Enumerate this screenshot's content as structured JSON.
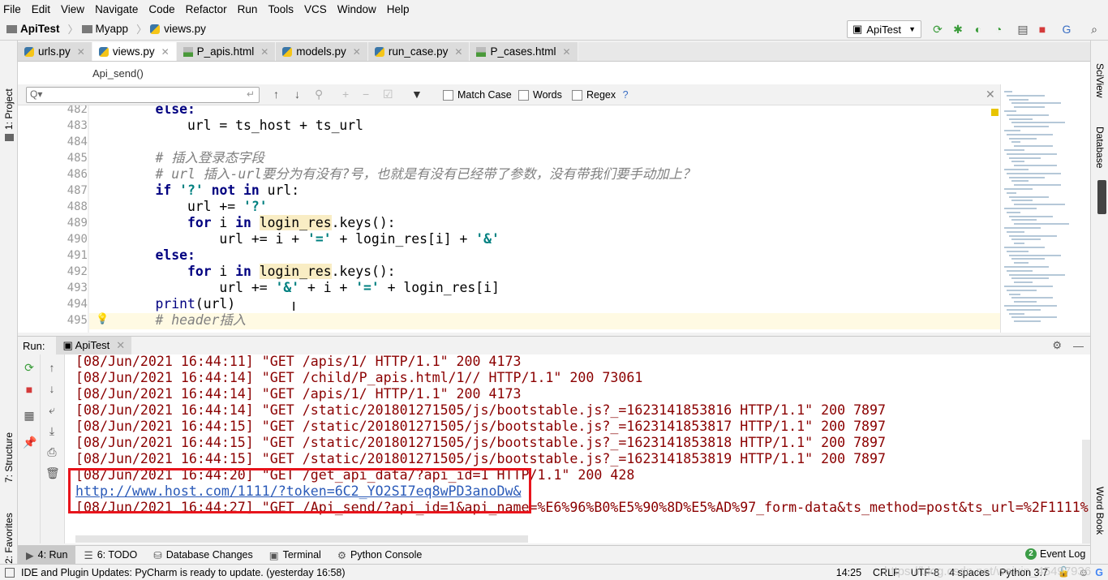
{
  "menu": [
    "File",
    "Edit",
    "View",
    "Navigate",
    "Code",
    "Refactor",
    "Run",
    "Tools",
    "VCS",
    "Window",
    "Help"
  ],
  "breadcrumb": [
    "ApiTest",
    "Myapp",
    "views.py"
  ],
  "run_config": "ApiTest",
  "tabs": [
    {
      "label": "urls.py",
      "type": "py"
    },
    {
      "label": "views.py",
      "type": "py",
      "active": true
    },
    {
      "label": "P_apis.html",
      "type": "html"
    },
    {
      "label": "models.py",
      "type": "py"
    },
    {
      "label": "run_case.py",
      "type": "py"
    },
    {
      "label": "P_cases.html",
      "type": "html"
    }
  ],
  "editor_breadcrumb": "Api_send()",
  "find": {
    "placeholder": "Q▾",
    "match_case": "Match Case",
    "words": "Words",
    "regex": "Regex",
    "help": "?"
  },
  "left_strip": {
    "project": "1: Project",
    "structure": "7: Structure",
    "favorites": "2: Favorites"
  },
  "right_strip": {
    "sciview": "SciView",
    "database": "Database",
    "wordbook": "Word Book"
  },
  "code": [
    {
      "n": "482",
      "t": [
        [
          "    else:",
          "kw"
        ]
      ]
    },
    {
      "n": "483",
      "t": [
        [
          "        url = ts_host + ts_url",
          ""
        ]
      ]
    },
    {
      "n": "484",
      "t": []
    },
    {
      "n": "485",
      "t": [
        [
          "    # 插入登录态字段",
          "cmt"
        ]
      ]
    },
    {
      "n": "486",
      "t": [
        [
          "    # url 插入-url要分为有没有?号，也就是有没有已经带了参数，没有带我们要手动加上？",
          "cmt"
        ]
      ]
    },
    {
      "n": "487",
      "t": [
        [
          "    ",
          ""
        ],
        [
          "if ",
          "kw"
        ],
        [
          "'?'",
          "str"
        ],
        [
          " ",
          ""
        ],
        [
          "not in",
          "kw"
        ],
        [
          " url:",
          ""
        ]
      ]
    },
    {
      "n": "488",
      "t": [
        [
          "        url += ",
          ""
        ],
        [
          "'?'",
          "str"
        ]
      ]
    },
    {
      "n": "489",
      "t": [
        [
          "        ",
          ""
        ],
        [
          "for",
          "kw"
        ],
        [
          " i ",
          ""
        ],
        [
          "in",
          "kw"
        ],
        [
          " ",
          ""
        ],
        [
          "login_res",
          "hl"
        ],
        [
          ".keys():",
          ""
        ]
      ]
    },
    {
      "n": "490",
      "t": [
        [
          "            url += i + ",
          ""
        ],
        [
          "'='",
          "str"
        ],
        [
          " + login_res[i] + ",
          ""
        ],
        [
          "'&'",
          "str"
        ]
      ]
    },
    {
      "n": "491",
      "t": [
        [
          "    ",
          ""
        ],
        [
          "else:",
          "kw"
        ]
      ]
    },
    {
      "n": "492",
      "t": [
        [
          "        ",
          ""
        ],
        [
          "for",
          "kw"
        ],
        [
          " i ",
          ""
        ],
        [
          "in",
          "kw"
        ],
        [
          " ",
          ""
        ],
        [
          "login_res",
          "hl"
        ],
        [
          ".keys():",
          ""
        ]
      ]
    },
    {
      "n": "493",
      "t": [
        [
          "            url += ",
          ""
        ],
        [
          "'&'",
          "str"
        ],
        [
          " + i + ",
          ""
        ],
        [
          "'='",
          "str"
        ],
        [
          " + login_res[i]",
          ""
        ]
      ]
    },
    {
      "n": "494",
      "t": [
        [
          "    ",
          ""
        ],
        [
          "print",
          "kw2"
        ],
        [
          "(url)",
          ""
        ]
      ]
    },
    {
      "n": "495",
      "t": [
        [
          "    # header插入",
          "cmt"
        ]
      ]
    }
  ],
  "run": {
    "label": "Run:",
    "config": "ApiTest",
    "output": [
      {
        "text": "[08/Jun/2021 16:44:11] \"GET /apis/1/ HTTP/1.1\" 200 4173"
      },
      {
        "text": "[08/Jun/2021 16:44:14] \"GET /child/P_apis.html/1// HTTP/1.1\" 200 73061"
      },
      {
        "text": "[08/Jun/2021 16:44:14] \"GET /apis/1/ HTTP/1.1\" 200 4173"
      },
      {
        "text": "[08/Jun/2021 16:44:14] \"GET /static/201801271505/js/bootstable.js?_=1623141853816 HTTP/1.1\" 200 7897"
      },
      {
        "text": "[08/Jun/2021 16:44:15] \"GET /static/201801271505/js/bootstable.js?_=1623141853817 HTTP/1.1\" 200 7897"
      },
      {
        "text": "[08/Jun/2021 16:44:15] \"GET /static/201801271505/js/bootstable.js?_=1623141853818 HTTP/1.1\" 200 7897"
      },
      {
        "text": "[08/Jun/2021 16:44:15] \"GET /static/201801271505/js/bootstable.js?_=1623141853819 HTTP/1.1\" 200 7897"
      },
      {
        "text": "[08/Jun/2021 16:44:20] \"GET /get_api_data/?api_id=1 HTTP/1.1\" 200 428"
      },
      {
        "text": "http://www.host.com/1111/?token=6C2_YO2SI7eq8wPD3anoDw&",
        "link": true
      },
      {
        "text": "[08/Jun/2021 16:44:27] \"GET /Api_send/?api_id=1&api_name=%E6%96%B0%E5%90%8D%E5%AD%97_form-data&ts_method=post&ts_url=%2F1111%"
      }
    ]
  },
  "bottom_tabs": [
    {
      "label": "4: Run",
      "active": true,
      "icon": "play-icon"
    },
    {
      "label": "6: TODO",
      "icon": "list-icon"
    },
    {
      "label": "Database Changes",
      "icon": "database-icon"
    },
    {
      "label": "Terminal",
      "icon": "terminal-icon"
    },
    {
      "label": "Python Console",
      "icon": "python-icon"
    }
  ],
  "event_log": {
    "count": "2",
    "label": "Event Log"
  },
  "status": {
    "message": "IDE and Plugin Updates: PyCharm is ready to update. (yesterday 16:58)",
    "position": "14:25",
    "line_sep": "CRLF",
    "encoding": "UTF-8",
    "indent": "4 spaces",
    "interpreter": "Python 3.7",
    "watermark": "https://blog.csdn.net/weixin_45497936"
  },
  "colors": {
    "highlight_box": "#e8141c",
    "console_text": "#8b0000",
    "link": "#2a5ab8",
    "keyword": "#000080",
    "string": "#008080"
  }
}
